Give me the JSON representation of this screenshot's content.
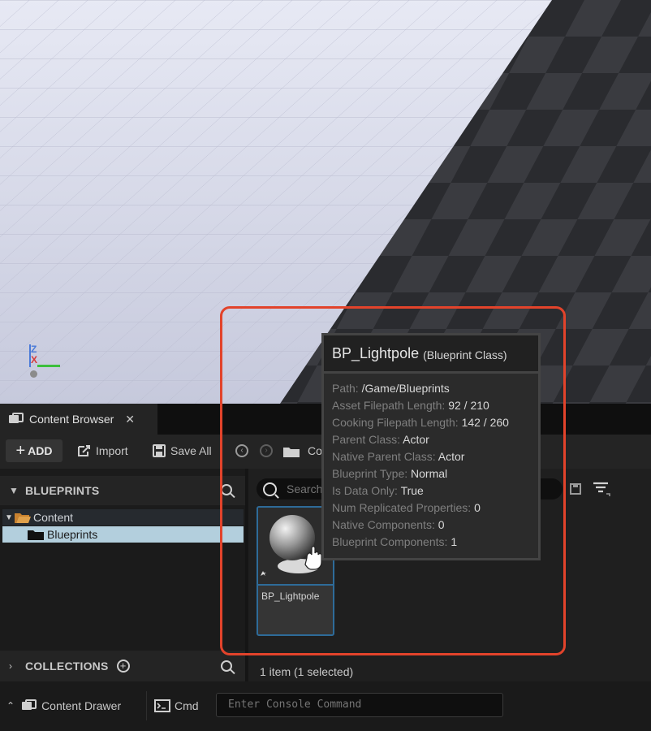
{
  "viewport": {
    "axis": {
      "z": "Z",
      "x": "X"
    }
  },
  "tabs": [
    {
      "label": "Content Browser",
      "close": "✕"
    }
  ],
  "toolbar": {
    "add_label": "ADD",
    "import_label": "Import",
    "save_all_label": "Save All",
    "path_label": "Co"
  },
  "sidebar": {
    "blueprints_title": "BLUEPRINTS",
    "tree": [
      {
        "label": "Content"
      },
      {
        "label": "Blueprints"
      }
    ],
    "collections_title": "COLLECTIONS"
  },
  "assets": {
    "search_placeholder": "Search",
    "items": [
      {
        "name": "BP_Lightpole"
      }
    ],
    "count_text": "1 item (1 selected)"
  },
  "tooltip": {
    "name": "BP_Lightpole",
    "type": "(Blueprint Class)",
    "rows": [
      {
        "key": "Path: ",
        "value": "/Game/Blueprints"
      },
      {
        "key": "Asset Filepath Length: ",
        "value": "92 / 210"
      },
      {
        "key": "Cooking Filepath Length: ",
        "value": "142 / 260"
      },
      {
        "key": "Parent Class: ",
        "value": "Actor"
      },
      {
        "key": "Native Parent Class: ",
        "value": "Actor"
      },
      {
        "key": "Blueprint Type: ",
        "value": "Normal"
      },
      {
        "key": "Is Data Only: ",
        "value": "True"
      },
      {
        "key": "Num Replicated Properties: ",
        "value": "0"
      },
      {
        "key": "Native Components: ",
        "value": "0"
      },
      {
        "key": "Blueprint Components: ",
        "value": "1"
      }
    ]
  },
  "bottom": {
    "drawer_label": "Content Drawer",
    "cmd_label": "Cmd",
    "console_placeholder": "Enter Console Command"
  },
  "colors": {
    "highlight": "#e2432b",
    "selection": "#2e6b99",
    "tree_selected": "#b3cfdd",
    "folder": "#d8963f"
  }
}
